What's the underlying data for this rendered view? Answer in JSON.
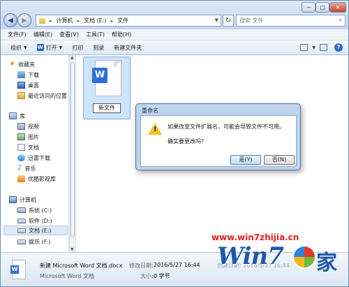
{
  "window": {
    "min_glyph": "─",
    "max_glyph": "□",
    "close_glyph": "✕"
  },
  "address": {
    "segments": [
      "计算机",
      "文档 (E:)",
      "文件"
    ],
    "search_placeholder": "搜索 文件"
  },
  "menu": [
    "文件(F)",
    "编辑(E)",
    "查看(V)",
    "工具(T)",
    "帮助(H)"
  ],
  "toolbar": {
    "organize": "组织",
    "open": "打开",
    "print": "打印",
    "burn": "刻录",
    "new_folder": "新建文件夹"
  },
  "nav": {
    "favorites": "收藏夹",
    "downloads": "下载",
    "desktop": "桌面",
    "recent": "最近访问的位置",
    "libraries": "库",
    "videos": "视频",
    "pictures": "图片",
    "documents": "文档",
    "xunlei": "迅雷下载",
    "music": "音乐",
    "youku": "优酷影视库",
    "computer": "计算机",
    "drive_c": "系统 (C:)",
    "drive_d": "软件 (D:)",
    "drive_e": "文档 (E:)",
    "drive_f": "娱乐 (F:)"
  },
  "content": {
    "file_name_editing": "新文件"
  },
  "dialog": {
    "title": "重命名",
    "message": "如果改变文件扩展名，可能会导致文件不可用。",
    "question": "确实要更改吗?",
    "yes": "是(Y)",
    "no": "否(N)"
  },
  "details": {
    "file_name": "新建 Microsoft Word 文档.docx",
    "file_type": "Microsoft Word 文档",
    "modified_label": "修改日期:",
    "modified_value": "2016/5/27 16:44",
    "size_label": "大小:",
    "size_value": "0 字节",
    "created_partial": "创建日期: 2016/5/27 16:44"
  },
  "watermark": {
    "url": "www.win7zhijia.cn",
    "logo": "Win7",
    "suffix": "家"
  }
}
